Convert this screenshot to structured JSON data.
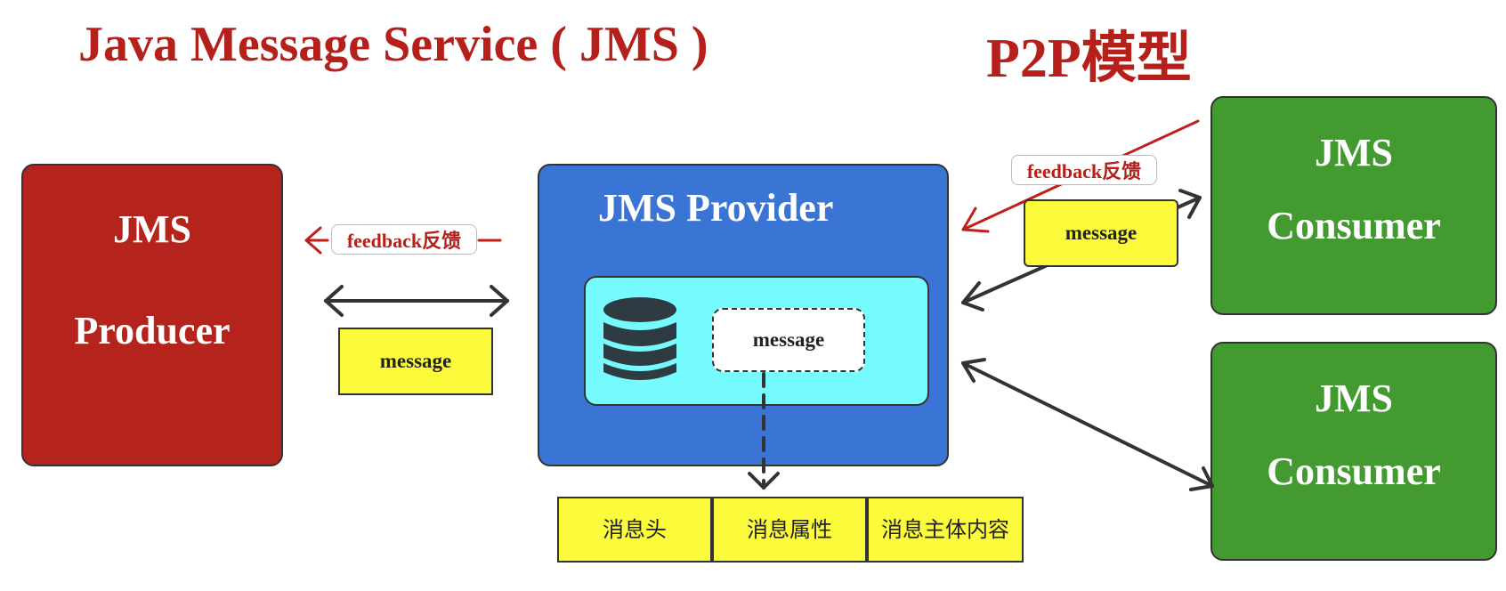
{
  "header": {
    "title": "Java Message Service ( JMS )",
    "model": "P2P模型"
  },
  "producer": {
    "line1": "JMS",
    "line2": "Producer"
  },
  "provider": {
    "title": "JMS Provider",
    "queue_message": "message",
    "icon": "database-icon"
  },
  "consumers": [
    {
      "line1": "JMS",
      "line2": "Consumer"
    },
    {
      "line1": "JMS",
      "line2": "Consumer"
    }
  ],
  "messages": {
    "producer_side": "message",
    "consumer_side": "message"
  },
  "feedback": {
    "producer_side": "feedback反馈",
    "consumer_side": "feedback反馈"
  },
  "message_parts": [
    "消息头",
    "消息属性",
    "消息主体内容"
  ],
  "colors": {
    "title_red": "#b5201a",
    "producer": "#b5241c",
    "provider": "#3a75d6",
    "queue": "#75fbfd",
    "consumer": "#429a31",
    "message_box": "#fbfb3c",
    "arrow": "#333333",
    "feedback_arrow": "#c0201a"
  }
}
